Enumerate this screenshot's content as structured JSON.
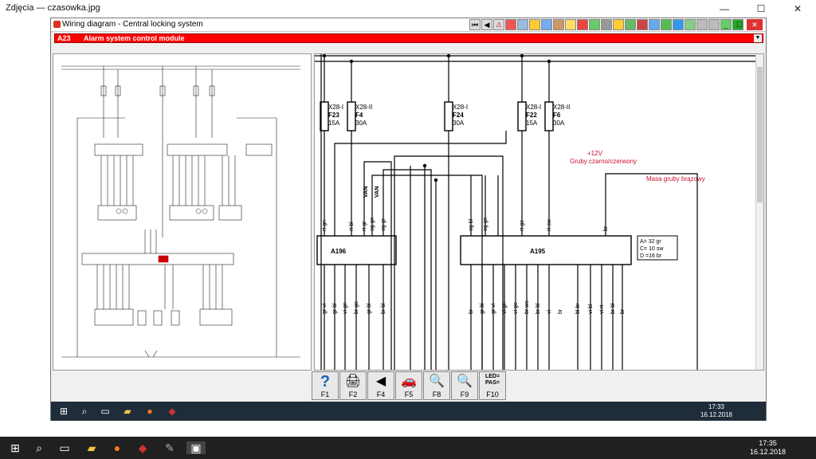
{
  "photos_app": {
    "title": "Zdjęcia — czasowka.jpg",
    "controls": [
      "—",
      "☐",
      "✕"
    ]
  },
  "app_window": {
    "title": "Wiring diagram - Central locking system",
    "controls": [
      "_",
      "☐",
      "✕"
    ],
    "component_code": "A23",
    "component_name": "Alarm system control module"
  },
  "diagram": {
    "fuses": [
      {
        "connector": "X28-I",
        "name": "F23",
        "rating": "15A"
      },
      {
        "connector": "X28-II",
        "name": "F4",
        "rating": "30A"
      },
      {
        "connector": "X28-I",
        "name": "F24",
        "rating": "30A"
      },
      {
        "connector": "X28-I",
        "name": "F22",
        "rating": "15A"
      },
      {
        "connector": "X28-II",
        "name": "F6",
        "rating": "30A"
      }
    ],
    "module_a196": "A196",
    "module_a195": "A195",
    "legend": [
      "A= 32 gr",
      "C= 10 sw",
      "D =16 br"
    ],
    "annotation_12v": "+12V",
    "annotation_thick_red": "Gruby czarno/czerwony",
    "annotation_ground": "Masa gruby brązowy",
    "wire_labels_top": [
      "rt gn",
      "rt bl",
      "rt gr",
      "og gn",
      "og gr",
      "VAN",
      "VAN",
      "og bl",
      "og gn",
      "rt ge",
      "rt sw",
      "br"
    ],
    "wire_labels_bottom": [
      "gr vi",
      "gr bl",
      "vi gn",
      "br ge",
      "gr bl",
      "br bl",
      "br",
      "gr bl",
      "gr vi",
      "vi gn",
      "vi ge",
      "br ws",
      "br bl",
      "vi",
      "br",
      "bl br",
      "vi bl",
      "vi rt",
      "br bl",
      "br"
    ]
  },
  "fkeys": [
    {
      "label": "F1",
      "icon": "help-icon",
      "glyph": "?"
    },
    {
      "label": "F2",
      "icon": "print-icon",
      "glyph": "🖨"
    },
    {
      "label": "F4",
      "icon": "back-icon",
      "glyph": "◀"
    },
    {
      "label": "F5",
      "icon": "car-icon",
      "glyph": "🚗"
    },
    {
      "label": "F8",
      "icon": "zoom-icon",
      "glyph": "🔍"
    },
    {
      "label": "F9",
      "icon": "zoom-out-icon",
      "glyph": "🔍"
    },
    {
      "label": "F10",
      "icon": "led-pas-icon",
      "glyph": "LED=\nPAS="
    }
  ],
  "inner_clock": {
    "time": "17:33",
    "date": "16.12.2018"
  },
  "outer_clock": {
    "time": "17:35",
    "date": "16.12.2018"
  }
}
